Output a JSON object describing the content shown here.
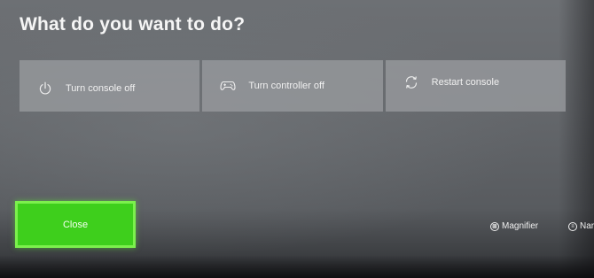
{
  "title": "What do you want to do?",
  "options": [
    {
      "label": "Turn console off",
      "icon": "power-icon"
    },
    {
      "label": "Turn controller off",
      "icon": "controller-icon"
    },
    {
      "label": "Restart console",
      "icon": "restart-icon"
    }
  ],
  "close_button": {
    "label": "Close",
    "accent_color": "#3ecf1c"
  },
  "hints": {
    "magnifier": {
      "label": "Magnifier",
      "icon": "view-button-icon"
    },
    "narrator": {
      "label": "Nar",
      "icon": "menu-button-icon"
    }
  }
}
